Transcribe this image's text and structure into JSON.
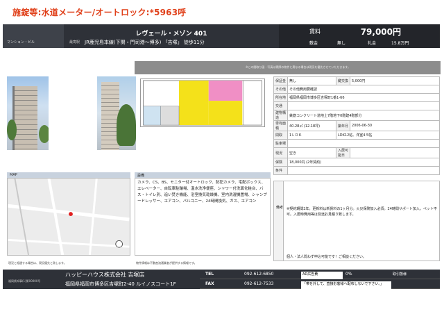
{
  "top_note": "施錠等:水道メーター/オートロック:*5963呼",
  "header": {
    "category": "マンション・ビル",
    "title": "レヴェール・メゾン 401",
    "route_label": "最寄駅",
    "route": "JR鹿児島本線(下関・門司港～博多) 「吉塚」 徒歩11分",
    "rent_label": "賃料",
    "rent": "79,000円",
    "deposit_label": "敷金",
    "deposit": "無し",
    "key_label": "礼金",
    "key": "15.8万円"
  },
  "bar_text": "※この間取り図・写真は実際の物件と異なる場合は現況を優先させていただきます。",
  "table": [
    {
      "label": "保証金",
      "value": "無し",
      "label2": "鍵交換",
      "value2": "5,000円"
    },
    {
      "label": "その他",
      "value": "その他費用要確認"
    },
    {
      "label": "所在地",
      "value": "福岡県福岡市博多区吉塚町1番1-66"
    },
    {
      "label": "交通",
      "value": ""
    },
    {
      "label": "建物構造",
      "value": "鉄筋コンクリート造地上7階地下0階建4階部分"
    },
    {
      "label": "専有面積",
      "value": "40.28㎡ (12.18坪)",
      "label2": "築年月",
      "value2": "2006-06-30"
    },
    {
      "label": "間取",
      "value": "1ＬＤＫ",
      "value2": "LDK12帖、洋室4.5帖"
    },
    {
      "label": "駐車場",
      "value": ""
    },
    {
      "label": "現況",
      "value": "空き",
      "label2": "入居可能日",
      "value2": ""
    },
    {
      "label": "保険",
      "value": "18,000円 (2年契約)"
    },
    {
      "label": "条件",
      "value": ""
    }
  ],
  "map_label": "MAP",
  "features_label": "設備",
  "features": "カメラ、CS、BS、モニター付オートロック、防犯カメラ、宅配ボックス、エレベーター、自転車駐輪場、温水洗浄便座、シャワー付洗面化粧台、バス・トイレ別、追い焚き機能、浴室換気乾燥機、室内洗濯機置場、シャンプードレッサー、エアコン、バルコニー、24時間換気、ガス、エアコン",
  "remarks_label": "備考",
  "remarks_text": "※契約期間2年。更新料は新賃料の1ヶ月分。火災保険加入必須。24時間サポート加入。ペット不可。入居時費用等は別途お見積り致します。",
  "remarks_bottom": "個人・法人問わず申込可能です！ご相談ください。",
  "foot_left": "現況と相違する場合は、現況優先と致します。",
  "foot_mid": "物件情報は不動産流通業者が提供する情報です。",
  "footer": {
    "license": "福岡県知事(1)第00000号",
    "company": "ハッピーハウス株式会社 吉塚店",
    "address": "福岡県福岡市博多区吉塚町2-40 ルイノスコート1F",
    "tel_label": "TEL",
    "tel": "092-612-6850",
    "fax_label": "FAX",
    "fax": "092-612-7533",
    "ad_label": "AD広告費",
    "ad_value": "0%",
    "share_label": "取引態様",
    "note": "「帯を外して、直接お客様へ配布しないで下さい。」"
  },
  "colors": {
    "accent": "#e0401a",
    "header_bg": "#2e3138"
  }
}
